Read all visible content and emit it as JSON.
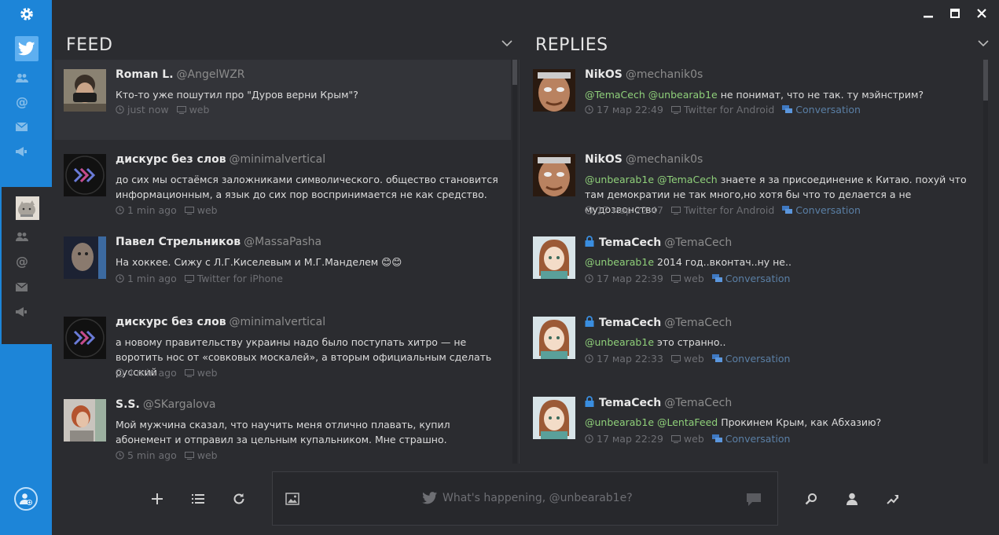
{
  "window": {
    "minimize": "▬",
    "maximize": "□",
    "close": "✕"
  },
  "rail": {
    "icons": [
      "gear-icon",
      "twitter-icon",
      "people-icon",
      "mention-icon",
      "mail-icon",
      "megaphone-icon",
      "add-account-icon"
    ]
  },
  "feed": {
    "title": "FEED",
    "tweets": [
      {
        "name": "Roman L.",
        "handle": "@AngelWZR",
        "text": "Кто-то уже пошутил про \"Дуров верни Крым\"?",
        "time": "just now",
        "source": "web"
      },
      {
        "name": "дискурс без слов",
        "handle": "@minimalvertical",
        "text": "до сих мы остаёмся заложниками символического. общество становится информационным, а язык до сих пор воспринимается не как средство.",
        "time": "1 min ago",
        "source": "web"
      },
      {
        "name": "Павел Стрельников",
        "handle": "@MassaPasha",
        "text": "На хоккее. Сижу с Л.Г.Киселевым и М.Г.Манделем 😊😊",
        "time": "1 min ago",
        "source": "Twitter for iPhone"
      },
      {
        "name": "дискурс без слов",
        "handle": "@minimalvertical",
        "text": "а новому правительству украины надо было поступать хитро — не воротить нос от «совковых москалей», а вторым официальным сделать русский",
        "time": "4 min ago",
        "source": "web"
      },
      {
        "name": "S.S.",
        "handle": "@SKargalova",
        "text": "Мой мужчина сказал, что научить меня отлично плавать, купил абонемент и отправил за цельным купальником. Мне страшно.",
        "time": "5 min ago",
        "source": "web"
      }
    ]
  },
  "replies": {
    "title": "REPLIES",
    "tweets": [
      {
        "name": "NikOS",
        "handle": "@mechanik0s",
        "mentions": "@TemaCech @unbearab1e",
        "text": " не понимат, что не так. ту мэйнстрим?",
        "time": "17 мар 22:49",
        "source": "Twitter for Android",
        "conv": "Conversation"
      },
      {
        "name": "NikOS",
        "handle": "@mechanik0s",
        "mentions": "@unbearab1e @TemaCech",
        "text": " знаете я за присоединение к Китаю. похуй что там демократии не так много,но хотя бы что то делается а не мудозвонство",
        "time": "17 мар 22:47",
        "source": "Twitter for Android",
        "conv": "Conversation"
      },
      {
        "name": "TemaCech",
        "handle": "@TemaCech",
        "mentions": "@unbearab1e",
        "text": " 2014 год..вконтач..ну не..",
        "time": "17 мар 22:39",
        "source": "web",
        "conv": "Conversation"
      },
      {
        "name": "TemaCech",
        "handle": "@TemaCech",
        "mentions": "@unbearab1e",
        "text": " это странно..",
        "time": "17 мар 22:33",
        "source": "web",
        "conv": "Conversation"
      },
      {
        "name": "TemaCech",
        "handle": "@TemaCech",
        "mentions": "@unbearab1e @LentaFeed",
        "text": " Прокинем Крым, как Абхазию?",
        "time": "17 мар 22:29",
        "source": "web",
        "conv": "Conversation"
      }
    ]
  },
  "compose": {
    "placeholder": "What's happening, @unbearab1e?"
  },
  "colors": {
    "rail": "#1d85d8",
    "bg": "#2b2c30",
    "mention": "#8fd07a",
    "conversation": "#5a7fa5"
  }
}
